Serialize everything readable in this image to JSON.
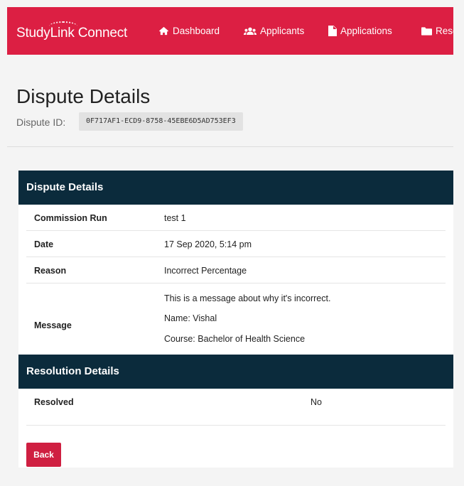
{
  "nav": {
    "brand": "StudyLink Connect",
    "items": [
      {
        "label": "Dashboard",
        "icon": "home-icon"
      },
      {
        "label": "Applicants",
        "icon": "users-icon"
      },
      {
        "label": "Applications",
        "icon": "file-icon"
      },
      {
        "label": "Resou",
        "icon": "folder-icon"
      }
    ]
  },
  "header": {
    "title": "Dispute Details",
    "id_label": "Dispute ID:",
    "id_value": "0F717AF1-ECD9-8758-45EBE6D5AD753EF3"
  },
  "dispute_section": {
    "title": "Dispute Details",
    "rows": [
      {
        "label": "Commission Run",
        "value": "test 1"
      },
      {
        "label": "Date",
        "value": "17 Sep 2020, 5:14 pm"
      },
      {
        "label": "Reason",
        "value": "Incorrect Percentage"
      }
    ],
    "message": {
      "label": "Message",
      "lines": [
        "This is a message about why it's incorrect.",
        "Name: Vishal",
        "Course: Bachelor of Health Science"
      ]
    }
  },
  "resolution_section": {
    "title": "Resolution Details",
    "rows": [
      {
        "label": "Resolved",
        "value": "No"
      }
    ]
  },
  "actions": {
    "back_label": "Back"
  },
  "colors": {
    "brand_red": "#dc1f43",
    "header_navy": "#0b2b3c",
    "button_red": "#cf1f41"
  }
}
